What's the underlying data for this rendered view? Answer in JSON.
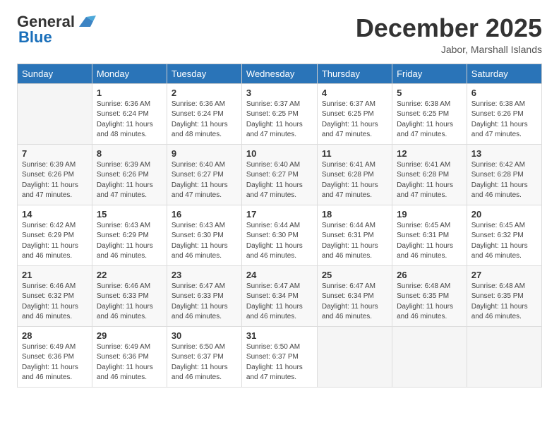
{
  "header": {
    "logo_general": "General",
    "logo_blue": "Blue",
    "month_title": "December 2025",
    "location": "Jabor, Marshall Islands"
  },
  "days_of_week": [
    "Sunday",
    "Monday",
    "Tuesday",
    "Wednesday",
    "Thursday",
    "Friday",
    "Saturday"
  ],
  "weeks": [
    [
      {
        "day": "",
        "sunrise": "",
        "sunset": "",
        "daylight": ""
      },
      {
        "day": "1",
        "sunrise": "Sunrise: 6:36 AM",
        "sunset": "Sunset: 6:24 PM",
        "daylight": "Daylight: 11 hours and 48 minutes."
      },
      {
        "day": "2",
        "sunrise": "Sunrise: 6:36 AM",
        "sunset": "Sunset: 6:24 PM",
        "daylight": "Daylight: 11 hours and 48 minutes."
      },
      {
        "day": "3",
        "sunrise": "Sunrise: 6:37 AM",
        "sunset": "Sunset: 6:25 PM",
        "daylight": "Daylight: 11 hours and 47 minutes."
      },
      {
        "day": "4",
        "sunrise": "Sunrise: 6:37 AM",
        "sunset": "Sunset: 6:25 PM",
        "daylight": "Daylight: 11 hours and 47 minutes."
      },
      {
        "day": "5",
        "sunrise": "Sunrise: 6:38 AM",
        "sunset": "Sunset: 6:25 PM",
        "daylight": "Daylight: 11 hours and 47 minutes."
      },
      {
        "day": "6",
        "sunrise": "Sunrise: 6:38 AM",
        "sunset": "Sunset: 6:26 PM",
        "daylight": "Daylight: 11 hours and 47 minutes."
      }
    ],
    [
      {
        "day": "7",
        "sunrise": "Sunrise: 6:39 AM",
        "sunset": "Sunset: 6:26 PM",
        "daylight": "Daylight: 11 hours and 47 minutes."
      },
      {
        "day": "8",
        "sunrise": "Sunrise: 6:39 AM",
        "sunset": "Sunset: 6:26 PM",
        "daylight": "Daylight: 11 hours and 47 minutes."
      },
      {
        "day": "9",
        "sunrise": "Sunrise: 6:40 AM",
        "sunset": "Sunset: 6:27 PM",
        "daylight": "Daylight: 11 hours and 47 minutes."
      },
      {
        "day": "10",
        "sunrise": "Sunrise: 6:40 AM",
        "sunset": "Sunset: 6:27 PM",
        "daylight": "Daylight: 11 hours and 47 minutes."
      },
      {
        "day": "11",
        "sunrise": "Sunrise: 6:41 AM",
        "sunset": "Sunset: 6:28 PM",
        "daylight": "Daylight: 11 hours and 47 minutes."
      },
      {
        "day": "12",
        "sunrise": "Sunrise: 6:41 AM",
        "sunset": "Sunset: 6:28 PM",
        "daylight": "Daylight: 11 hours and 47 minutes."
      },
      {
        "day": "13",
        "sunrise": "Sunrise: 6:42 AM",
        "sunset": "Sunset: 6:28 PM",
        "daylight": "Daylight: 11 hours and 46 minutes."
      }
    ],
    [
      {
        "day": "14",
        "sunrise": "Sunrise: 6:42 AM",
        "sunset": "Sunset: 6:29 PM",
        "daylight": "Daylight: 11 hours and 46 minutes."
      },
      {
        "day": "15",
        "sunrise": "Sunrise: 6:43 AM",
        "sunset": "Sunset: 6:29 PM",
        "daylight": "Daylight: 11 hours and 46 minutes."
      },
      {
        "day": "16",
        "sunrise": "Sunrise: 6:43 AM",
        "sunset": "Sunset: 6:30 PM",
        "daylight": "Daylight: 11 hours and 46 minutes."
      },
      {
        "day": "17",
        "sunrise": "Sunrise: 6:44 AM",
        "sunset": "Sunset: 6:30 PM",
        "daylight": "Daylight: 11 hours and 46 minutes."
      },
      {
        "day": "18",
        "sunrise": "Sunrise: 6:44 AM",
        "sunset": "Sunset: 6:31 PM",
        "daylight": "Daylight: 11 hours and 46 minutes."
      },
      {
        "day": "19",
        "sunrise": "Sunrise: 6:45 AM",
        "sunset": "Sunset: 6:31 PM",
        "daylight": "Daylight: 11 hours and 46 minutes."
      },
      {
        "day": "20",
        "sunrise": "Sunrise: 6:45 AM",
        "sunset": "Sunset: 6:32 PM",
        "daylight": "Daylight: 11 hours and 46 minutes."
      }
    ],
    [
      {
        "day": "21",
        "sunrise": "Sunrise: 6:46 AM",
        "sunset": "Sunset: 6:32 PM",
        "daylight": "Daylight: 11 hours and 46 minutes."
      },
      {
        "day": "22",
        "sunrise": "Sunrise: 6:46 AM",
        "sunset": "Sunset: 6:33 PM",
        "daylight": "Daylight: 11 hours and 46 minutes."
      },
      {
        "day": "23",
        "sunrise": "Sunrise: 6:47 AM",
        "sunset": "Sunset: 6:33 PM",
        "daylight": "Daylight: 11 hours and 46 minutes."
      },
      {
        "day": "24",
        "sunrise": "Sunrise: 6:47 AM",
        "sunset": "Sunset: 6:34 PM",
        "daylight": "Daylight: 11 hours and 46 minutes."
      },
      {
        "day": "25",
        "sunrise": "Sunrise: 6:47 AM",
        "sunset": "Sunset: 6:34 PM",
        "daylight": "Daylight: 11 hours and 46 minutes."
      },
      {
        "day": "26",
        "sunrise": "Sunrise: 6:48 AM",
        "sunset": "Sunset: 6:35 PM",
        "daylight": "Daylight: 11 hours and 46 minutes."
      },
      {
        "day": "27",
        "sunrise": "Sunrise: 6:48 AM",
        "sunset": "Sunset: 6:35 PM",
        "daylight": "Daylight: 11 hours and 46 minutes."
      }
    ],
    [
      {
        "day": "28",
        "sunrise": "Sunrise: 6:49 AM",
        "sunset": "Sunset: 6:36 PM",
        "daylight": "Daylight: 11 hours and 46 minutes."
      },
      {
        "day": "29",
        "sunrise": "Sunrise: 6:49 AM",
        "sunset": "Sunset: 6:36 PM",
        "daylight": "Daylight: 11 hours and 46 minutes."
      },
      {
        "day": "30",
        "sunrise": "Sunrise: 6:50 AM",
        "sunset": "Sunset: 6:37 PM",
        "daylight": "Daylight: 11 hours and 46 minutes."
      },
      {
        "day": "31",
        "sunrise": "Sunrise: 6:50 AM",
        "sunset": "Sunset: 6:37 PM",
        "daylight": "Daylight: 11 hours and 47 minutes."
      },
      {
        "day": "",
        "sunrise": "",
        "sunset": "",
        "daylight": ""
      },
      {
        "day": "",
        "sunrise": "",
        "sunset": "",
        "daylight": ""
      },
      {
        "day": "",
        "sunrise": "",
        "sunset": "",
        "daylight": ""
      }
    ]
  ]
}
